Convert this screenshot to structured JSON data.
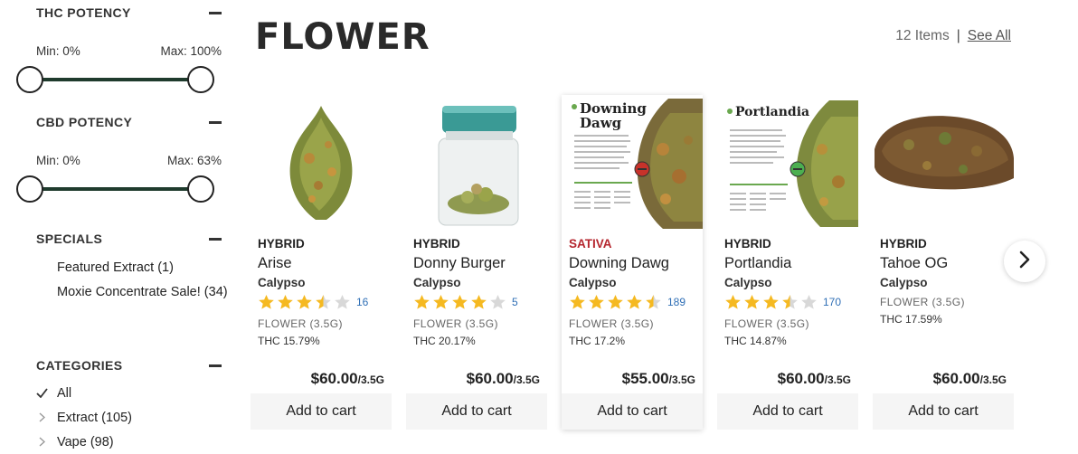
{
  "filters": {
    "thc": {
      "title": "THC POTENCY",
      "min_label": "Min: 0%",
      "max_label": "Max: 100%",
      "min": 0,
      "max": 100
    },
    "cbd": {
      "title": "CBD POTENCY",
      "min_label": "Min: 0%",
      "max_label": "Max: 63%",
      "min": 0,
      "max": 63
    },
    "specials": {
      "title": "SPECIALS",
      "items": [
        "Featured Extract (1)",
        "Moxie Concentrate Sale! (34)"
      ]
    },
    "categories": {
      "title": "CATEGORIES",
      "items": [
        {
          "label": "All",
          "icon": "check-icon"
        },
        {
          "label": "Extract (105)",
          "icon": "chevron-right-icon"
        },
        {
          "label": "Vape (98)",
          "icon": "chevron-right-icon"
        }
      ]
    }
  },
  "main": {
    "title": "FLOWER",
    "items_count": "12 Items",
    "separator": "|",
    "see_all": "See All"
  },
  "products": [
    {
      "type": "HYBRID",
      "name": "Arise",
      "brand": "Calypso",
      "rating": 3.5,
      "reviews": "16",
      "weight": "FLOWER (3.5G)",
      "thc": "THC 15.79%",
      "price": "$60.00",
      "unit": "/3.5G",
      "cart": "Add to cart"
    },
    {
      "type": "HYBRID",
      "name": "Donny Burger",
      "brand": "Calypso",
      "rating": 4,
      "reviews": "5",
      "weight": "FLOWER (3.5G)",
      "thc": "THC 20.17%",
      "price": "$60.00",
      "unit": "/3.5G",
      "cart": "Add to cart"
    },
    {
      "type": "SATIVA",
      "name": "Downing Dawg",
      "brand": "Calypso",
      "rating": 4.5,
      "reviews": "189",
      "weight": "FLOWER (3.5G)",
      "thc": "THC 17.2%",
      "price": "$55.00",
      "unit": "/3.5G",
      "cart": "Add to cart"
    },
    {
      "type": "HYBRID",
      "name": "Portlandia",
      "brand": "Calypso",
      "rating": 3.5,
      "reviews": "170",
      "weight": "FLOWER (3.5G)",
      "thc": "THC 14.87%",
      "price": "$60.00",
      "unit": "/3.5G",
      "cart": "Add to cart"
    },
    {
      "type": "HYBRID",
      "name": "Tahoe OG",
      "brand": "Calypso",
      "rating": null,
      "reviews": null,
      "weight": "FLOWER (3.5G)",
      "thc": "THC 17.59%",
      "price": "$60.00",
      "unit": "/3.5G",
      "cart": "Add to cart"
    }
  ],
  "labels_in_images": {
    "card3": "Downing Dawg",
    "card4": "Portlandia"
  },
  "colors": {
    "star": "#f5b921",
    "star_empty": "#d8d8d8",
    "sativa": "#b5262e",
    "slider_track": "#1f3b2d",
    "review_link": "#2f6fb6"
  },
  "next_icon": "chevron-right-icon"
}
